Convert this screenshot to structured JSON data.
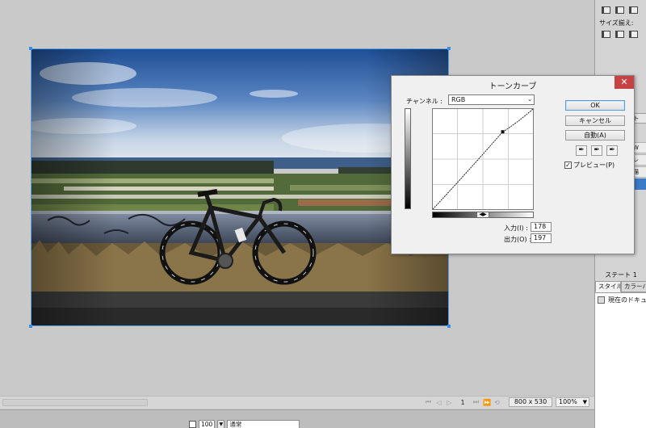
{
  "right_panel": {
    "size_align_label": "サイズ揃え:",
    "state_label": "ステート 1",
    "tabs": [
      "スタイル",
      "カラーパ"
    ],
    "doc_item": "現在のドキュ",
    "side_tab": "ト",
    "list_items": [
      "W",
      "レ",
      "描"
    ]
  },
  "status_bar": {
    "page": "1",
    "image_size": "800 x 530",
    "zoom": "100%"
  },
  "bottom_bar": {
    "value": "100",
    "blend_mode": "通常"
  },
  "dialog": {
    "title": "トーンカーブ",
    "close": "✕",
    "channel_label": "チャンネル :",
    "channel_value": "RGB",
    "ok": "OK",
    "cancel": "キャンセル",
    "auto": "自動(A)",
    "preview_label": "プレビュー(P)",
    "preview_checked": true,
    "input_label": "入力(I) :",
    "input_value": "178",
    "output_label": "出力(O) :",
    "output_value": "197",
    "curve_point": {
      "input": 178,
      "output": 197
    }
  }
}
